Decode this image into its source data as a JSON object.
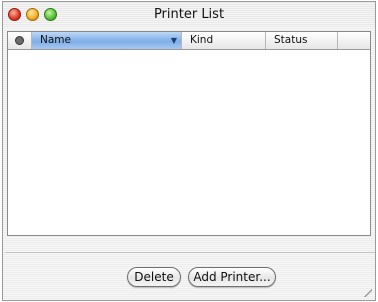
{
  "window": {
    "title": "Printer List"
  },
  "table": {
    "columns": [
      {
        "label": ""
      },
      {
        "label": "Name",
        "selected": true,
        "sort_indicator": "▼"
      },
      {
        "label": "Kind"
      },
      {
        "label": "Status"
      }
    ],
    "rows": []
  },
  "buttons": {
    "delete": "Delete",
    "add_printer": "Add Printer..."
  },
  "colors": {
    "selected_header": "#7eaee8",
    "close": "#e0402c",
    "minimize": "#f2b12a",
    "zoom": "#5cc23a"
  }
}
